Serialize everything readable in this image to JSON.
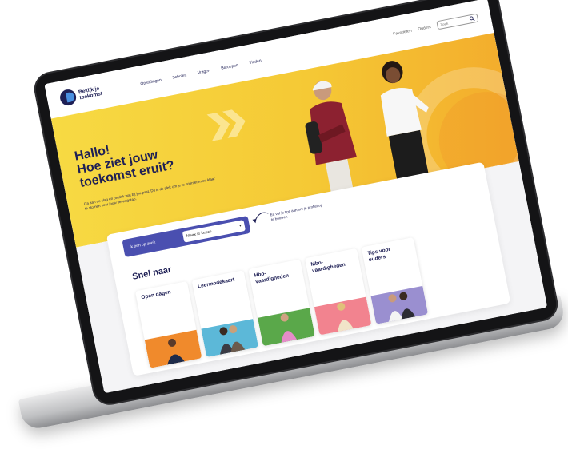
{
  "site": {
    "logo_text": "Bekijk je toekomst",
    "nav": [
      "Opleidingen",
      "Scholen",
      "Vragen",
      "Beroepen",
      "Vinden"
    ],
    "utility": [
      "Favorieten",
      "Ouders"
    ],
    "search_placeholder": "Zoek"
  },
  "hero": {
    "title": "Hallo!\nHoe ziet jouw\ntoekomst eruit?",
    "intro": "Ga aan de slag en ontdek wat bij jou past. Dit is de plek om je te oriënteren en klaar te stomen voor jouw vervolgstap."
  },
  "cta": {
    "label": "Ik ben op zoek",
    "select_value": "Maak je keuze",
    "hint": "En vul je tips aan om je profiel op te bouwen"
  },
  "quicklinks": {
    "title": "Snel naar",
    "cards": [
      {
        "label": "Open dagen",
        "color": "#f08a2c"
      },
      {
        "label": "Leermodekaart",
        "color": "#5cb8d8"
      },
      {
        "label": "Hbo-\nvaardigheden",
        "color": "#5aa84a"
      },
      {
        "label": "Mbo-\nvaardigheden",
        "color": "#f2838f"
      },
      {
        "label": "Tips voor\nouders",
        "color": "#9a8fd0"
      }
    ]
  },
  "colors": {
    "brand_navy": "#1e1f55",
    "hero_yellow": "#f7da43",
    "cta_purple": "#4a4fb0"
  }
}
